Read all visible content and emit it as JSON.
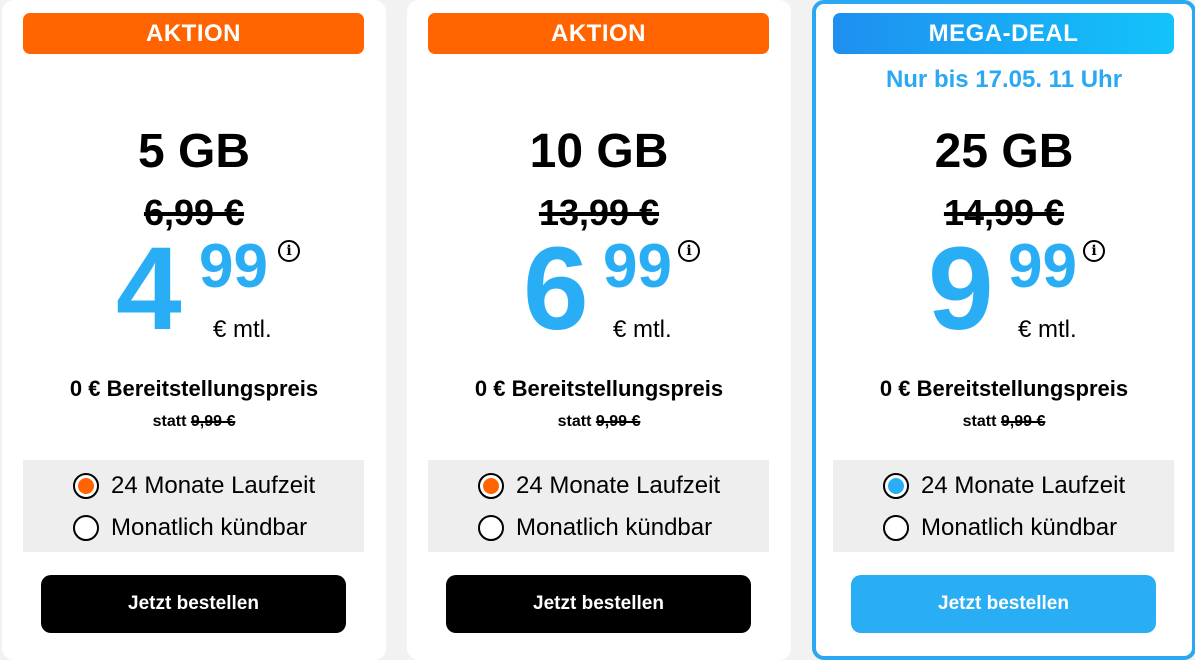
{
  "colors": {
    "action_orange": "#ff6400",
    "price_blue": "#29aef5",
    "mega_border": "#2aa8f2"
  },
  "tariffs": [
    {
      "badge": "AKTION",
      "data_volume": "5 GB",
      "old_price": "6,99 €",
      "price_whole": "4",
      "price_cents": "99",
      "price_unit": "€ mtl.",
      "setup_fee": "0 € Bereitstellungspreis",
      "setup_instead_prefix": "statt",
      "setup_instead_value": "9,99 €",
      "term_options": [
        "24 Monate Laufzeit",
        "Monatlich kündbar"
      ],
      "selected_term": "24 Monate Laufzeit",
      "button_label": "Jetzt bestellen"
    },
    {
      "badge": "AKTION",
      "data_volume": "10 GB",
      "old_price": "13,99 €",
      "price_whole": "6",
      "price_cents": "99",
      "price_unit": "€ mtl.",
      "setup_fee": "0 € Bereitstellungspreis",
      "setup_instead_prefix": "statt",
      "setup_instead_value": "9,99 €",
      "term_options": [
        "24 Monate Laufzeit",
        "Monatlich kündbar"
      ],
      "selected_term": "24 Monate Laufzeit",
      "button_label": "Jetzt bestellen"
    },
    {
      "badge": "MEGA-DEAL",
      "subline": "Nur bis 17.05. 11 Uhr",
      "data_volume": "25 GB",
      "old_price": "14,99 €",
      "price_whole": "9",
      "price_cents": "99",
      "price_unit": "€ mtl.",
      "setup_fee": "0 € Bereitstellungspreis",
      "setup_instead_prefix": "statt",
      "setup_instead_value": "9,99 €",
      "term_options": [
        "24 Monate Laufzeit",
        "Monatlich kündbar"
      ],
      "selected_term": "24 Monate Laufzeit",
      "button_label": "Jetzt bestellen"
    }
  ],
  "info_icon_glyph": "i"
}
